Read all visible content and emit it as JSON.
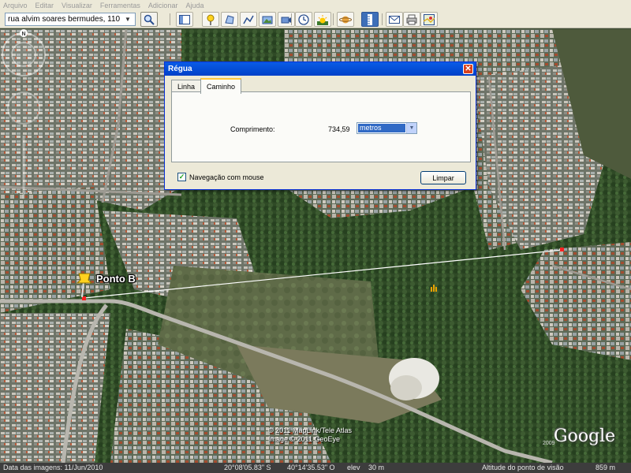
{
  "menu": [
    "Arquivo",
    "Editar",
    "Visualizar",
    "Ferramentas",
    "Adicionar",
    "Ajuda"
  ],
  "search": {
    "value": "rua alvim soares bermudes, 110"
  },
  "toolbar": {
    "icons": [
      "search-icon",
      "sidebar-toggle-icon",
      "placemark-pin-icon",
      "polygon-icon",
      "path-icon",
      "image-overlay-icon",
      "record-tour-icon",
      "historical-imagery-icon",
      "sunlight-icon",
      "planets-icon",
      "ruler-icon",
      "email-icon",
      "print-icon",
      "google-maps-icon"
    ]
  },
  "map": {
    "placemark_label": "Ponto B",
    "copyright_line1": "© 2011 MapLink/Tele Atlas",
    "copyright_line2": "Image © 2011 GeoEye",
    "logo_text": "Google",
    "logo_year": "2009",
    "compass_letter": "N"
  },
  "dialog": {
    "title": "Régua",
    "tabs": [
      "Linha",
      "Caminho"
    ],
    "active_tab": "Caminho",
    "length_label": "Comprimento:",
    "length_value": "734,59",
    "unit": "metros",
    "mouse_nav_label": "Navegação com mouse",
    "mouse_nav_checked": true,
    "clear_label": "Limpar"
  },
  "status": {
    "imagery_date": "Data das imagens: 11/Jun/2010",
    "latitude": "20°08'05.83\" S",
    "longitude": "40°14'35.53\" O",
    "elevation_label": "elev",
    "elevation": "30 m",
    "eye_alt_label": "Altitude do ponto de visão",
    "eye_alt": "859 m"
  },
  "colors": {
    "dialog_title": "#0a5ce6",
    "ruler_line": "#ffffff",
    "path_endpoint": "#ff0000"
  }
}
